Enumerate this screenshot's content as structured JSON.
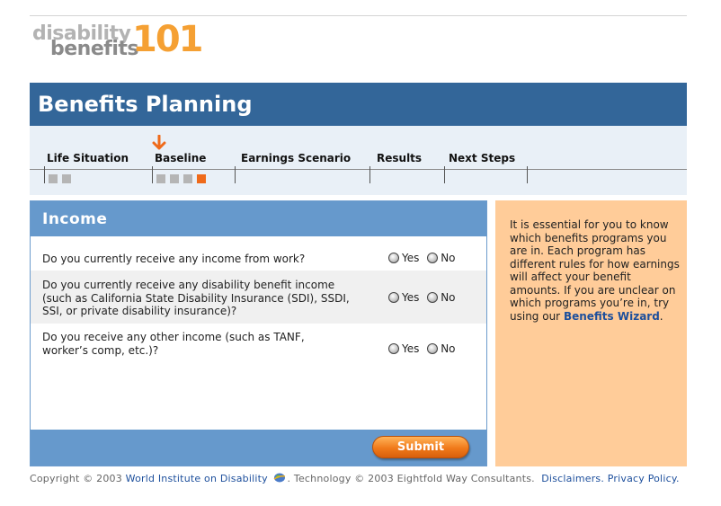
{
  "logo": {
    "word1": "disability",
    "word2": "benefits",
    "number": "101"
  },
  "page_title": "Benefits Planning",
  "steps": [
    {
      "label": "Life Situation",
      "squares": 2,
      "active_index": -1
    },
    {
      "label": "Baseline",
      "squares": 4,
      "active_index": 3
    },
    {
      "label": "Earnings Scenario",
      "squares": 0,
      "active_index": -1
    },
    {
      "label": "Results",
      "squares": 0,
      "active_index": -1
    },
    {
      "label": "Next Steps",
      "squares": 0,
      "active_index": -1
    }
  ],
  "current_step": "Baseline",
  "income": {
    "title": "Income",
    "questions": [
      {
        "text": "Do you currently receive any income from work?",
        "yes": "Yes",
        "no": "No"
      },
      {
        "text": "Do you currently receive any disability benefit income (such as California State Disability Insurance (SDI), SSDI, SSI, or private disability insurance)?",
        "yes": "Yes",
        "no": "No"
      },
      {
        "text": "Do you receive any other income (such as TANF, worker’s comp, etc.)?",
        "yes": "Yes",
        "no": "No"
      }
    ],
    "submit_label": "Submit"
  },
  "side_panel": {
    "text": "It is essential for you to know which benefits programs you are in. Each program has different rules for how earnings will affect your benefit amounts. If you are unclear on which programs you’re in, try using our",
    "link": "Benefits Wizard",
    "suffix": "."
  },
  "footer": {
    "copyright": "Copyright © 2003",
    "wid_link": "World Institute on Disability",
    "technology": ".  Technology © 2003 Eightfold Way Consultants.",
    "disclaimers": "Disclaimers.",
    "privacy": "Privacy Policy."
  },
  "colors": {
    "header": "#336699",
    "panel_head": "#6699cc",
    "side_panel": "#ffcc99",
    "accent": "#ef6a1a",
    "link": "#1d4f9c"
  }
}
